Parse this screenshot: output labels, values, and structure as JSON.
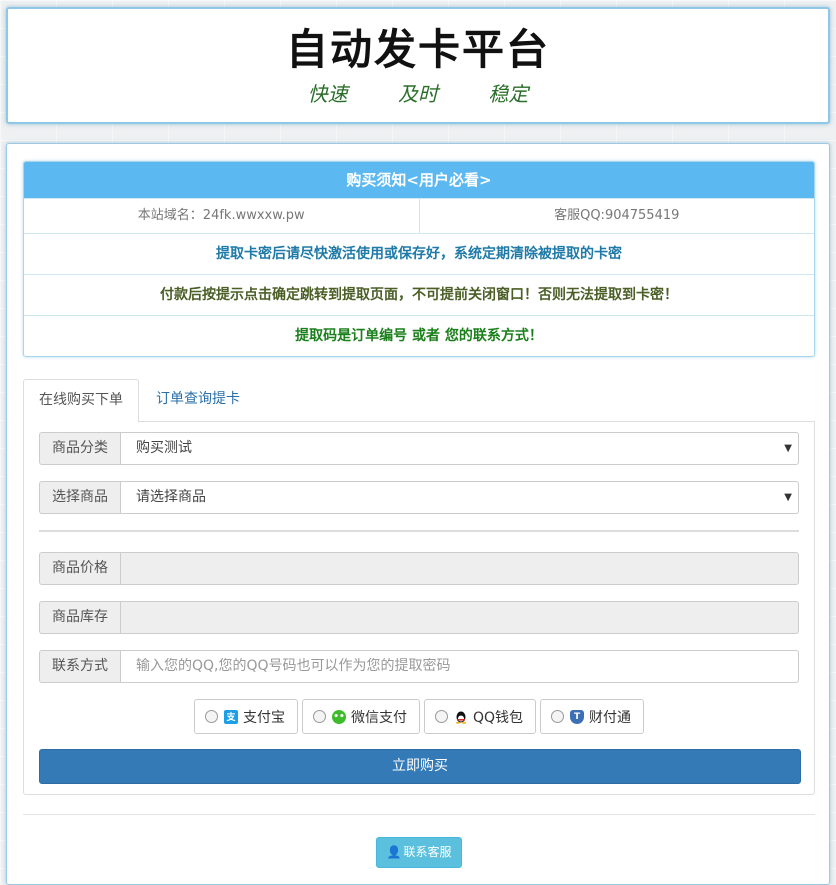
{
  "header": {
    "title": "自动发卡平台",
    "slogan": [
      "快速",
      "及时",
      "稳定"
    ]
  },
  "notice": {
    "heading": "购买须知<用户必看>",
    "domain": "本站域名：24fk.wwxxw.pw",
    "support_qq": "客服QQ:904755419",
    "messages": [
      "提取卡密后请尽快激活使用或保存好，系统定期清除被提取的卡密",
      "付款后按提示点击确定跳转到提取页面，不可提前关闭窗口！否则无法提取到卡密！",
      "提取码是订单编号 或者 您的联系方式！"
    ]
  },
  "tabs": [
    {
      "label": "在线购买下单",
      "active": true
    },
    {
      "label": "订单查询提卡",
      "active": false
    }
  ],
  "form": {
    "category": {
      "label": "商品分类",
      "value": "购买测试"
    },
    "product": {
      "label": "选择商品",
      "value": "请选择商品"
    },
    "price": {
      "label": "商品价格",
      "value": ""
    },
    "stock": {
      "label": "商品库存",
      "value": ""
    },
    "contact": {
      "label": "联系方式",
      "placeholder": "输入您的QQ,您的QQ号码也可以作为您的提取密码"
    }
  },
  "payment_methods": [
    {
      "label": "支付宝",
      "icon": "alipay-icon",
      "color": "#1c9fe5"
    },
    {
      "label": "微信支付",
      "icon": "wechat-icon",
      "color": "#3dbb2b"
    },
    {
      "label": "QQ钱包",
      "icon": "qq-icon",
      "color": "#111111"
    },
    {
      "label": "财付通",
      "icon": "tenpay-icon",
      "color": "#3d6fb5"
    }
  ],
  "buy_button": "立即购买",
  "contact_button": "联系客服",
  "colors": {
    "accent": "#337ab7",
    "notice_header": "#5bb8f0",
    "info_button": "#5bc0de"
  }
}
